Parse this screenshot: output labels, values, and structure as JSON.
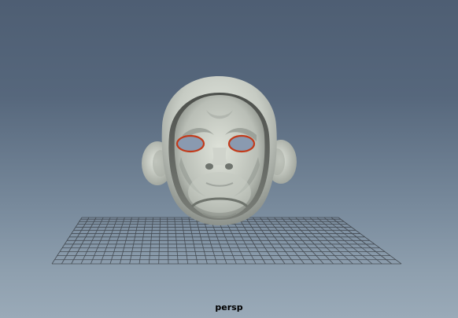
{
  "viewport": {
    "camera_label": "persp",
    "background_top": "#4e5e73",
    "background_bottom": "#9aaab8",
    "grid_color": "#3a3f45",
    "model": {
      "name": "monkey-mask",
      "base_color": "#c9cec6",
      "eye_rim_color": "#c23a1a"
    }
  }
}
